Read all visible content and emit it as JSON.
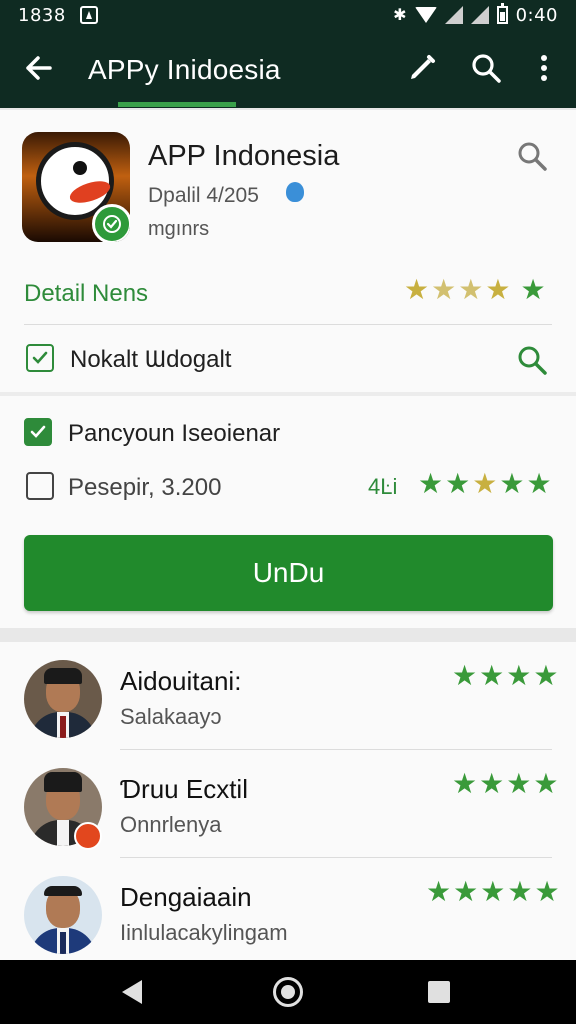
{
  "status_bar": {
    "time": "1838",
    "clock": "0:40",
    "bluetooth_icon": "bluetooth-icon",
    "wifi_icon": "wifi-icon"
  },
  "app_bar": {
    "title": "APPy Inidoesia",
    "back_icon": "arrow-back-icon",
    "edit_icon": "pen-icon",
    "search_icon": "search-icon",
    "more_icon": "more-vert-icon",
    "accent": "#3aa14a"
  },
  "app": {
    "title": "APP Indonesia",
    "date": "Dpalil 4/205",
    "subtitle": "mgınrs",
    "verified_icon": "verified-badge-icon"
  },
  "details": {
    "label": "Detail Nens",
    "stars": 5,
    "row1_label": "Nokalt Ɯdogalt",
    "row2_label": "Pancyoun Iseoienar",
    "row3_label": "Pesepir, 3.200",
    "rating_value": "4Ŀi",
    "rating_stars": 5
  },
  "cta": {
    "label": "UnDu",
    "color": "#218a2c"
  },
  "reviews": [
    {
      "name": "Aidouitani:",
      "text": "Salakaayɔ",
      "stars": 4
    },
    {
      "name": "Ɗruu Ecxtil",
      "text": "Onnrlenya",
      "stars": 4
    },
    {
      "name": "Dengaiaain",
      "text": "Iinlulacakylingam",
      "stars": 5
    }
  ],
  "nav": {
    "back": "nav-back-icon",
    "home": "nav-home-icon",
    "recent": "nav-recent-icon"
  }
}
